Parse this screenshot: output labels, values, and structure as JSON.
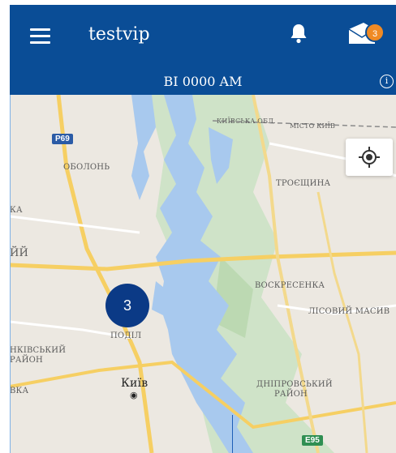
{
  "header": {
    "title": "testvip",
    "menu_icon": "hamburger-icon",
    "bell_icon": "bell-icon",
    "messages_icon": "notifications-icon",
    "badge_count": "3"
  },
  "vehicle": {
    "plate": "BI 0000 AM",
    "info_icon": "info-icon",
    "info_glyph": "i"
  },
  "map": {
    "cluster_count": "3",
    "locate_icon": "crosshair-icon",
    "road_badges": {
      "p69": "P69",
      "e95": "E95"
    },
    "places": {
      "obolon": "ОБОЛОНЬ",
      "troieshchyna": "ТРОЄЩИНА",
      "voskresenka": "ВОСКРЕСЕНКА",
      "lisovyi": "ЛІСОВИЙ МАСИВ",
      "podil": "ПОДІЛ",
      "shevchenkivskyi1": "НКІВСЬКИЙ",
      "shevchenkivskyi2": "РАЙОН",
      "kyiv": "Київ",
      "dniprovskyi1": "ДНІПРОВСЬКИЙ",
      "dniprovskyi2": "РАЙОН",
      "vka": "ВКА",
      "ka": "КА",
      "yi": "ЙЙ",
      "border1": "КИЇВСЬКА ОБЛ.",
      "border2": "МІСТО КИЇВ"
    }
  }
}
